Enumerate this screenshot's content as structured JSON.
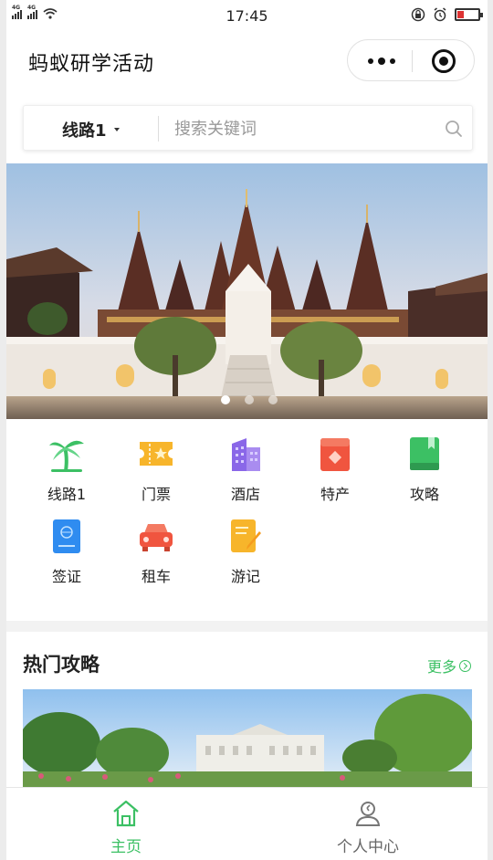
{
  "status": {
    "network": "4G",
    "time": "17:45"
  },
  "header": {
    "title": "蚂蚁研学活动"
  },
  "search": {
    "route_label": "线路1",
    "placeholder": "搜索关键词"
  },
  "banner": {
    "slide_count": 3,
    "active_slide": 1
  },
  "categories": [
    {
      "label": "线路1",
      "icon": "palm-tree-icon",
      "color": "#3cc064"
    },
    {
      "label": "门票",
      "icon": "ticket-icon",
      "color": "#f7b52b"
    },
    {
      "label": "酒店",
      "icon": "hotel-building-icon",
      "color": "#8a67e8"
    },
    {
      "label": "特产",
      "icon": "gift-icon",
      "color": "#f0553f"
    },
    {
      "label": "攻略",
      "icon": "guide-book-icon",
      "color": "#3cc064"
    },
    {
      "label": "签证",
      "icon": "passport-icon",
      "color": "#2f8cf0"
    },
    {
      "label": "租车",
      "icon": "car-icon",
      "color": "#f0553f"
    },
    {
      "label": "游记",
      "icon": "travel-note-icon",
      "color": "#f7b52b"
    }
  ],
  "hot": {
    "title": "热门攻略",
    "more_label": "更多"
  },
  "tabbar": {
    "home_label": "主页",
    "profile_label": "个人中心",
    "active_color": "#3cc064",
    "inactive_color": "#666666"
  }
}
